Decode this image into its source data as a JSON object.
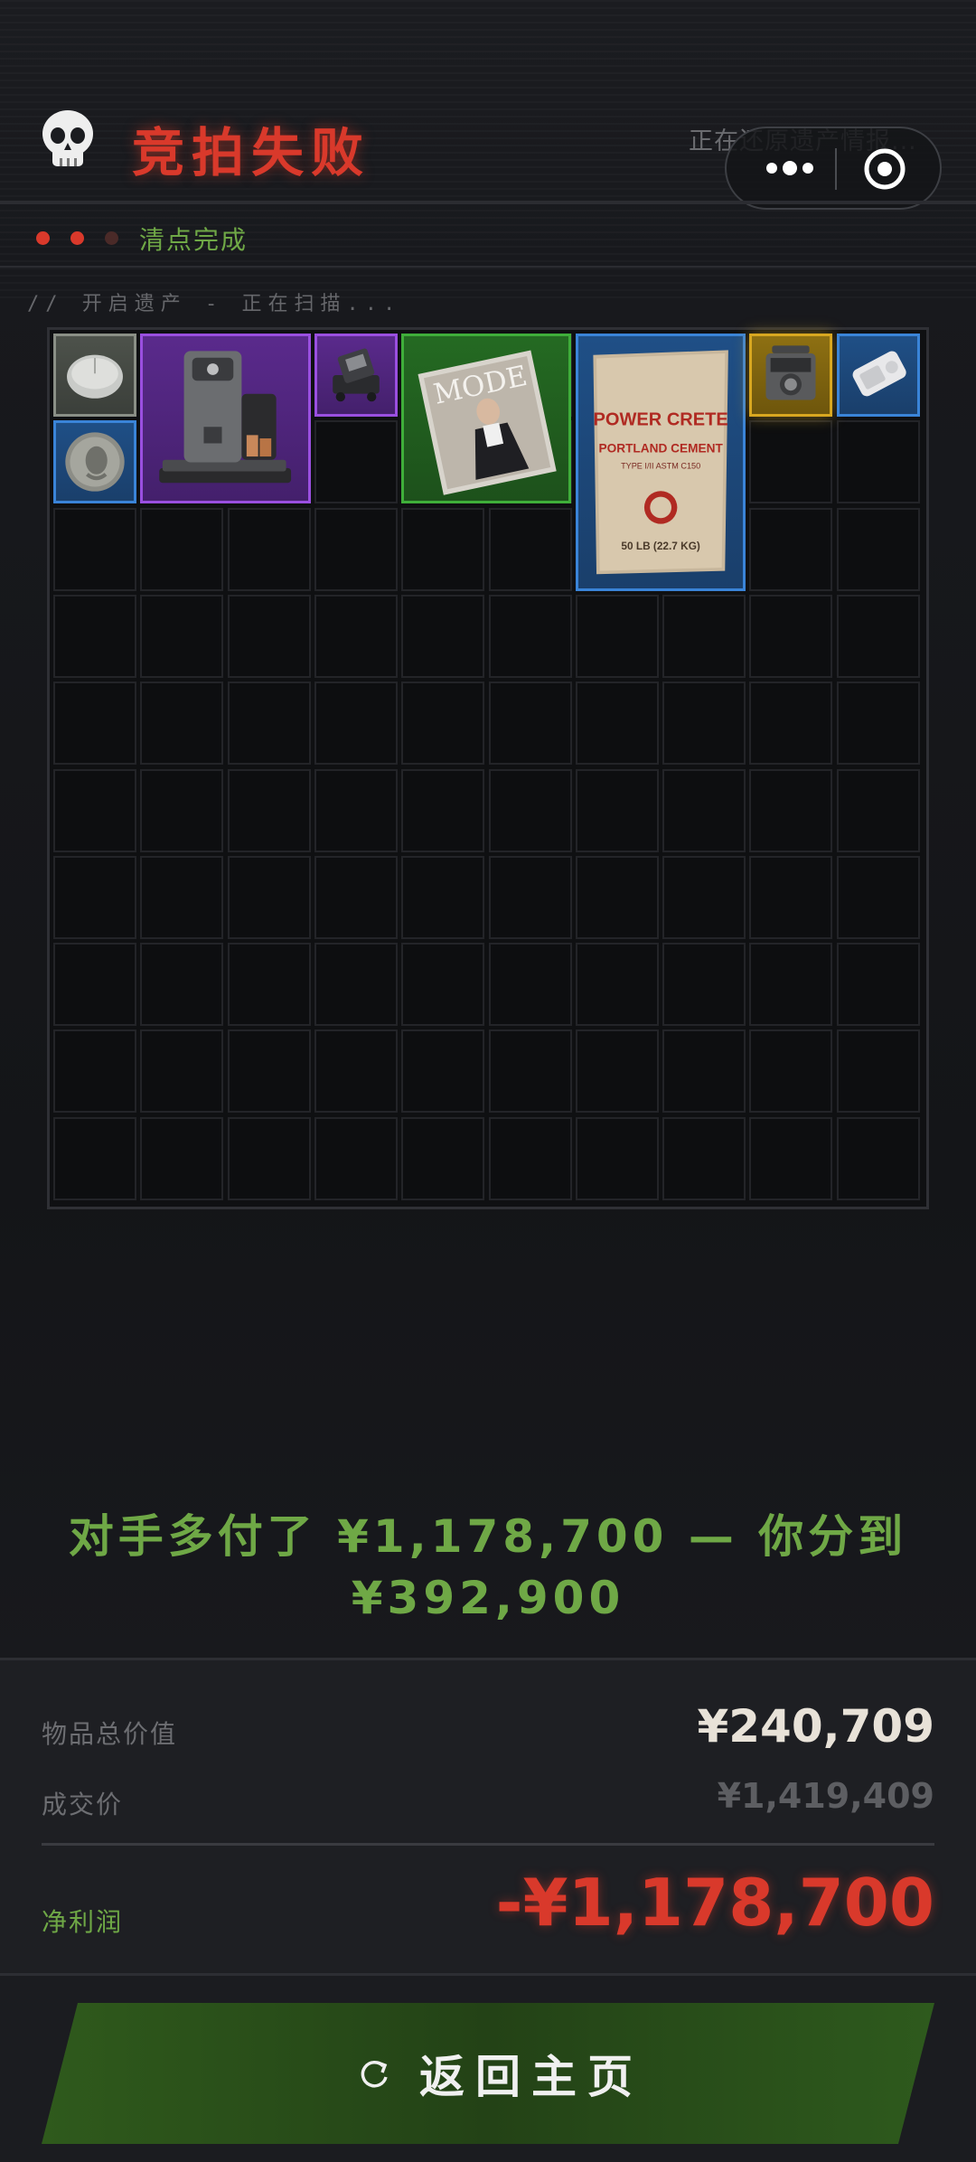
{
  "header": {
    "title": "竞拍失败",
    "restore_text": "正在还原遗产情报...",
    "skull_icon": "skull-icon",
    "menu_icon": "more-dots-icon",
    "close_icon": "target-icon"
  },
  "status": {
    "text": "清点完成",
    "dot_colors": [
      "#d9392b",
      "#d9392b",
      "#4a2a28"
    ]
  },
  "scan_label": "// 开启遗产 - 正在扫描...",
  "grid": {
    "columns": 10,
    "rows": 10,
    "items": [
      {
        "name": "mouse",
        "icon": "mouse-icon",
        "rarity": "gray",
        "col": 0,
        "row": 0,
        "w": 1,
        "h": 1
      },
      {
        "name": "coffee-machine",
        "icon": "coffee-machine-icon",
        "rarity": "purple",
        "col": 1,
        "row": 0,
        "w": 2,
        "h": 2
      },
      {
        "name": "gadget",
        "icon": "gadget-icon",
        "rarity": "purple",
        "col": 3,
        "row": 0,
        "w": 1,
        "h": 1
      },
      {
        "name": "magazine",
        "icon": "magazine-icon",
        "rarity": "green",
        "col": 4,
        "row": 0,
        "w": 2,
        "h": 2
      },
      {
        "name": "cement-bag",
        "icon": "cement-bag-icon",
        "rarity": "blue",
        "col": 6,
        "row": 0,
        "w": 2,
        "h": 3
      },
      {
        "name": "radio",
        "icon": "radio-icon",
        "rarity": "gold",
        "col": 8,
        "row": 0,
        "w": 1,
        "h": 1
      },
      {
        "name": "device",
        "icon": "device-icon",
        "rarity": "blue",
        "col": 9,
        "row": 0,
        "w": 1,
        "h": 1
      },
      {
        "name": "coin",
        "icon": "coin-icon",
        "rarity": "blue",
        "col": 0,
        "row": 1,
        "w": 1,
        "h": 1
      }
    ],
    "magazine_title": "MODE",
    "cement_brand": "POWER CRETE",
    "cement_type": "PORTLAND CEMENT",
    "cement_sub": "TYPE I/II ASTM C150",
    "cement_weight": "50 LB (22.7 KG)"
  },
  "message": {
    "line1": "对手多付了 ¥1,178,700 — 你分到",
    "line2": "¥392,900"
  },
  "summary": {
    "total_value_label": "物品总价值",
    "total_value": "¥240,709",
    "deal_price_label": "成交价",
    "deal_price": "¥1,419,409",
    "net_profit_label": "净利润",
    "net_profit": "-¥1,178,700",
    "net_profit_color": "#d9392b"
  },
  "button": {
    "label": "返回主页",
    "icon": "refresh-icon"
  }
}
